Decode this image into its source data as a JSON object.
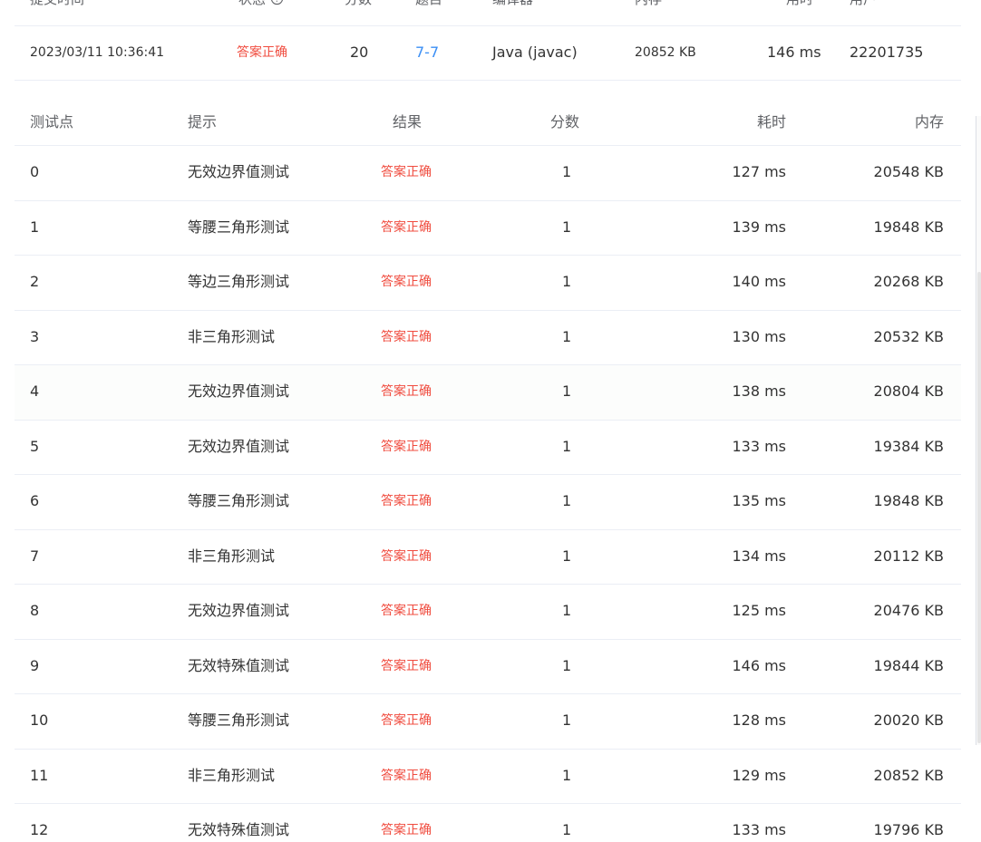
{
  "summary": {
    "headers": {
      "submit_time": "提交时间",
      "status": "状态",
      "score": "分数",
      "problem": "题目",
      "compiler": "编译器",
      "memory": "内存",
      "time": "用时",
      "user": "用户"
    },
    "row": {
      "submit_time": "2023/03/11 10:36:41",
      "status": "答案正确",
      "score": "20",
      "problem": "7-7",
      "compiler": "Java (javac)",
      "memory": "20852 KB",
      "time": "146 ms",
      "user": "22201735"
    }
  },
  "cases": {
    "headers": {
      "id": "测试点",
      "hint": "提示",
      "result": "结果",
      "score": "分数",
      "time": "耗时",
      "memory": "内存"
    },
    "rows": [
      {
        "id": "0",
        "hint": "无效边界值测试",
        "result": "答案正确",
        "score": "1",
        "time": "127 ms",
        "memory": "20548 KB"
      },
      {
        "id": "1",
        "hint": "等腰三角形测试",
        "result": "答案正确",
        "score": "1",
        "time": "139 ms",
        "memory": "19848 KB"
      },
      {
        "id": "2",
        "hint": "等边三角形测试",
        "result": "答案正确",
        "score": "1",
        "time": "140 ms",
        "memory": "20268 KB"
      },
      {
        "id": "3",
        "hint": "非三角形测试",
        "result": "答案正确",
        "score": "1",
        "time": "130 ms",
        "memory": "20532 KB"
      },
      {
        "id": "4",
        "hint": "无效边界值测试",
        "result": "答案正确",
        "score": "1",
        "time": "138 ms",
        "memory": "20804 KB"
      },
      {
        "id": "5",
        "hint": "无效边界值测试",
        "result": "答案正确",
        "score": "1",
        "time": "133 ms",
        "memory": "19384 KB"
      },
      {
        "id": "6",
        "hint": "等腰三角形测试",
        "result": "答案正确",
        "score": "1",
        "time": "135 ms",
        "memory": "19848 KB"
      },
      {
        "id": "7",
        "hint": "非三角形测试",
        "result": "答案正确",
        "score": "1",
        "time": "134 ms",
        "memory": "20112 KB"
      },
      {
        "id": "8",
        "hint": "无效边界值测试",
        "result": "答案正确",
        "score": "1",
        "time": "125 ms",
        "memory": "20476 KB"
      },
      {
        "id": "9",
        "hint": "无效特殊值测试",
        "result": "答案正确",
        "score": "1",
        "time": "146 ms",
        "memory": "19844 KB"
      },
      {
        "id": "10",
        "hint": "等腰三角形测试",
        "result": "答案正确",
        "score": "1",
        "time": "128 ms",
        "memory": "20020 KB"
      },
      {
        "id": "11",
        "hint": "非三角形测试",
        "result": "答案正确",
        "score": "1",
        "time": "129 ms",
        "memory": "20852 KB"
      },
      {
        "id": "12",
        "hint": "无效特殊值测试",
        "result": "答案正确",
        "score": "1",
        "time": "133 ms",
        "memory": "19796 KB"
      }
    ]
  },
  "colors": {
    "accepted": "#f04c3f",
    "link": "#3b8ff5",
    "divider": "#ebeef5"
  },
  "icons": {
    "status_help": "help-circle-icon"
  }
}
